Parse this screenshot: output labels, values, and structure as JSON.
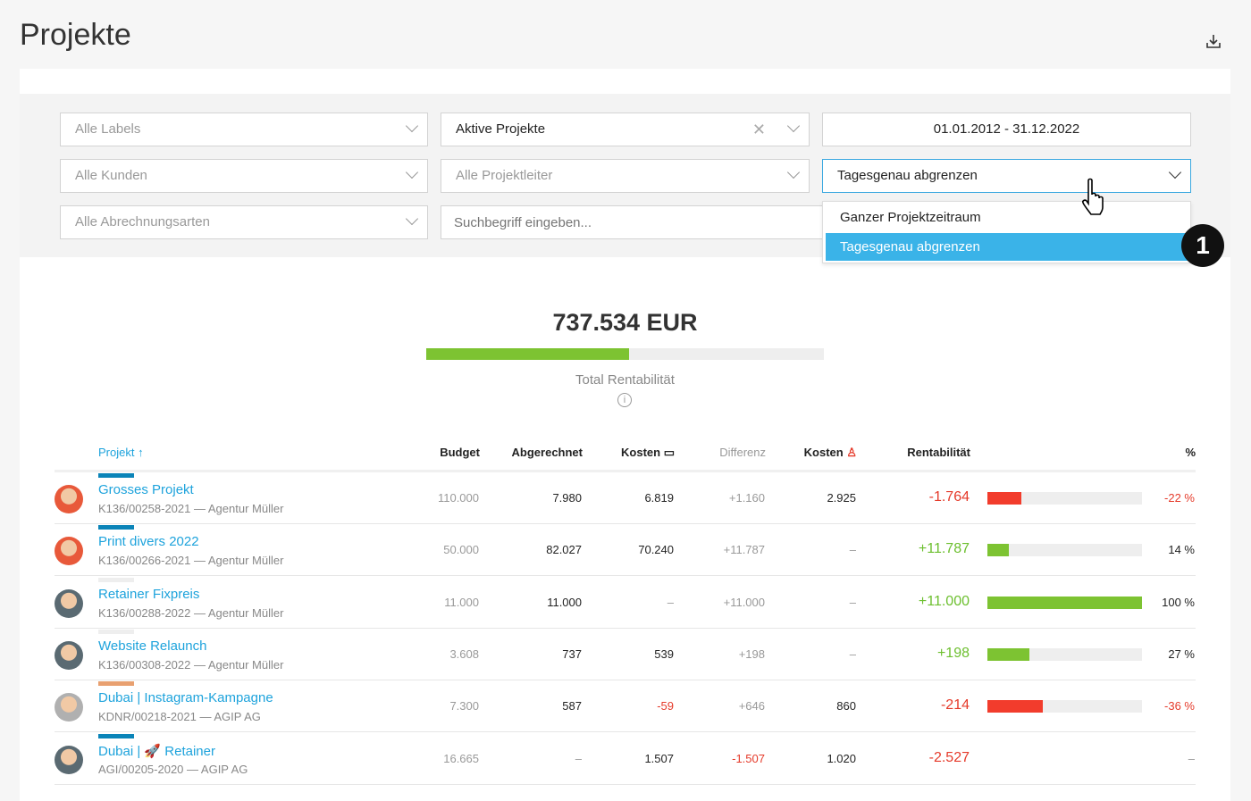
{
  "header": {
    "title": "Projekte",
    "download_icon": "download-icon"
  },
  "filters": {
    "labels": "Alle Labels",
    "status": "Aktive Projekte",
    "daterange": "01.01.2012 - 31.12.2022",
    "clients": "Alle Kunden",
    "managers": "Alle Projektleiter",
    "period": "Tagesgenau abgrenzen",
    "billing": "Alle Abrechnungsarten",
    "search_placeholder": "Suchbegriff eingeben...",
    "period_options": [
      "Ganzer Projektzeitraum",
      "Tagesgenau abgrenzen"
    ],
    "period_selected": "Tagesgenau abgrenzen"
  },
  "annotation": "1",
  "summary": {
    "total": "737.534 EUR",
    "label": "Total Rentabilität",
    "fill_percent": 51,
    "color": "#7dc332"
  },
  "table": {
    "headers": {
      "project": "Projekt",
      "budget": "Budget",
      "billed": "Abgerechnet",
      "costs": "Kosten",
      "diff": "Differenz",
      "costs2": "Kosten",
      "rent": "Rentabilität",
      "pct": "%"
    },
    "rows": [
      {
        "name": "Grosses Projekt",
        "sub": "K136/00258-2021 — Agentur Müller",
        "budget": "110.000",
        "billed": "7.980",
        "costs": "6.819",
        "diff": "+1.160",
        "costs2": "2.925",
        "rent": "-1.764",
        "pct": "-22 %",
        "bar": 22,
        "neg": true,
        "stripe": "#0b84b8",
        "avatar": "#e8593a"
      },
      {
        "name": "Print divers 2022",
        "sub": "K136/00266-2021 — Agentur Müller",
        "budget": "50.000",
        "billed": "82.027",
        "costs": "70.240",
        "diff": "+11.787",
        "costs2": "–",
        "rent": "+11.787",
        "pct": "14 %",
        "bar": 14,
        "neg": false,
        "stripe": "#0b84b8",
        "avatar": "#e8593a"
      },
      {
        "name": "Retainer Fixpreis",
        "sub": "K136/00288-2022 — Agentur Müller",
        "budget": "11.000",
        "billed": "11.000",
        "costs": "–",
        "diff": "+11.000",
        "costs2": "–",
        "rent": "+11.000",
        "pct": "100 %",
        "bar": 100,
        "neg": false,
        "stripe": "#eeeeee",
        "avatar": "#5a6a72"
      },
      {
        "name": "Website Relaunch",
        "sub": "K136/00308-2022 — Agentur Müller",
        "budget": "3.608",
        "billed": "737",
        "costs": "539",
        "diff": "+198",
        "costs2": "–",
        "rent": "+198",
        "pct": "27 %",
        "bar": 27,
        "neg": false,
        "stripe": "#eeeeee",
        "avatar": "#5a6a72"
      },
      {
        "name": "Dubai | Instagram-Kampagne",
        "sub": "KDNR/00218-2021 — AGIP AG",
        "budget": "7.300",
        "billed": "587",
        "costs": "-59",
        "diff": "+646",
        "costs2": "860",
        "rent": "-214",
        "pct": "-36 %",
        "bar": 36,
        "neg": true,
        "stripe": "#e8a070",
        "avatar": "#b0b0b0",
        "costs_neg": true
      },
      {
        "name": "Dubai | 🚀 Retainer",
        "sub": "AGI/00205-2020 — AGIP AG",
        "budget": "16.665",
        "billed": "–",
        "costs": "1.507",
        "diff": "-1.507",
        "costs2": "1.020",
        "rent": "-2.527",
        "pct": "–",
        "bar": 0,
        "neg": true,
        "stripe": "#0b84b8",
        "avatar": "#5a6a72",
        "diff_neg": true
      }
    ]
  }
}
